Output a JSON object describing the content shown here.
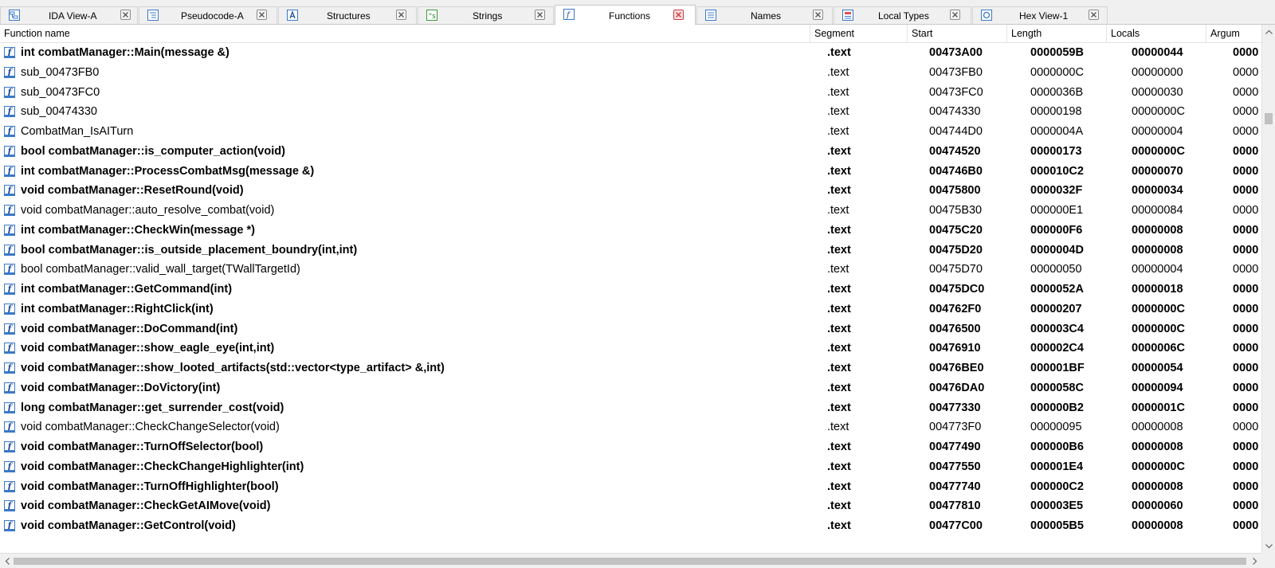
{
  "tabs": [
    {
      "label": "IDA View-A",
      "icon": "ida-view-icon"
    },
    {
      "label": "Pseudocode-A",
      "icon": "pseudocode-icon"
    },
    {
      "label": "Structures",
      "icon": "structures-icon"
    },
    {
      "label": "Strings",
      "icon": "strings-icon"
    },
    {
      "label": "Functions",
      "icon": "functions-icon",
      "active": true
    },
    {
      "label": "Names",
      "icon": "names-icon"
    },
    {
      "label": "Local Types",
      "icon": "local-types-icon"
    },
    {
      "label": "Hex View-1",
      "icon": "hex-view-icon"
    }
  ],
  "columns": {
    "name": "Function name",
    "segment": "Segment",
    "start": "Start",
    "length": "Length",
    "locals": "Locals",
    "arguments": "Argum"
  },
  "colors": {
    "accent_blue": "#3a78c8",
    "active_close_red": "#c94040"
  },
  "functions": [
    {
      "name": "int combatManager::Main(message &)",
      "segment": ".text",
      "start": "00473A00",
      "length": "0000059B",
      "locals": "00000044",
      "args": "0000",
      "bold": true
    },
    {
      "name": "sub_00473FB0",
      "segment": ".text",
      "start": "00473FB0",
      "length": "0000000C",
      "locals": "00000000",
      "args": "0000",
      "bold": false
    },
    {
      "name": "sub_00473FC0",
      "segment": ".text",
      "start": "00473FC0",
      "length": "0000036B",
      "locals": "00000030",
      "args": "0000",
      "bold": false
    },
    {
      "name": "sub_00474330",
      "segment": ".text",
      "start": "00474330",
      "length": "00000198",
      "locals": "0000000C",
      "args": "0000",
      "bold": false
    },
    {
      "name": "CombatMan_IsAITurn",
      "segment": ".text",
      "start": "004744D0",
      "length": "0000004A",
      "locals": "00000004",
      "args": "0000",
      "bold": false
    },
    {
      "name": "bool combatManager::is_computer_action(void)",
      "segment": ".text",
      "start": "00474520",
      "length": "00000173",
      "locals": "0000000C",
      "args": "0000",
      "bold": true
    },
    {
      "name": "int combatManager::ProcessCombatMsg(message &)",
      "segment": ".text",
      "start": "004746B0",
      "length": "000010C2",
      "locals": "00000070",
      "args": "0000",
      "bold": true
    },
    {
      "name": "void combatManager::ResetRound(void)",
      "segment": ".text",
      "start": "00475800",
      "length": "0000032F",
      "locals": "00000034",
      "args": "0000",
      "bold": true
    },
    {
      "name": "void combatManager::auto_resolve_combat(void)",
      "segment": ".text",
      "start": "00475B30",
      "length": "000000E1",
      "locals": "00000084",
      "args": "0000",
      "bold": false
    },
    {
      "name": "int combatManager::CheckWin(message *)",
      "segment": ".text",
      "start": "00475C20",
      "length": "000000F6",
      "locals": "00000008",
      "args": "0000",
      "bold": true
    },
    {
      "name": "bool combatManager::is_outside_placement_boundry(int,int)",
      "segment": ".text",
      "start": "00475D20",
      "length": "0000004D",
      "locals": "00000008",
      "args": "0000",
      "bold": true
    },
    {
      "name": "bool combatManager::valid_wall_target(TWallTargetId)",
      "segment": ".text",
      "start": "00475D70",
      "length": "00000050",
      "locals": "00000004",
      "args": "0000",
      "bold": false
    },
    {
      "name": "int combatManager::GetCommand(int)",
      "segment": ".text",
      "start": "00475DC0",
      "length": "0000052A",
      "locals": "00000018",
      "args": "0000",
      "bold": true
    },
    {
      "name": "int combatManager::RightClick(int)",
      "segment": ".text",
      "start": "004762F0",
      "length": "00000207",
      "locals": "0000000C",
      "args": "0000",
      "bold": true
    },
    {
      "name": "void combatManager::DoCommand(int)",
      "segment": ".text",
      "start": "00476500",
      "length": "000003C4",
      "locals": "0000000C",
      "args": "0000",
      "bold": true
    },
    {
      "name": "void combatManager::show_eagle_eye(int,int)",
      "segment": ".text",
      "start": "00476910",
      "length": "000002C4",
      "locals": "0000006C",
      "args": "0000",
      "bold": true
    },
    {
      "name": "void combatManager::show_looted_artifacts(std::vector<type_artifact> &,int)",
      "segment": ".text",
      "start": "00476BE0",
      "length": "000001BF",
      "locals": "00000054",
      "args": "0000",
      "bold": true
    },
    {
      "name": "void combatManager::DoVictory(int)",
      "segment": ".text",
      "start": "00476DA0",
      "length": "0000058C",
      "locals": "00000094",
      "args": "0000",
      "bold": true
    },
    {
      "name": "long combatManager::get_surrender_cost(void)",
      "segment": ".text",
      "start": "00477330",
      "length": "000000B2",
      "locals": "0000001C",
      "args": "0000",
      "bold": true
    },
    {
      "name": "void combatManager::CheckChangeSelector(void)",
      "segment": ".text",
      "start": "004773F0",
      "length": "00000095",
      "locals": "00000008",
      "args": "0000",
      "bold": false
    },
    {
      "name": "void combatManager::TurnOffSelector(bool)",
      "segment": ".text",
      "start": "00477490",
      "length": "000000B6",
      "locals": "00000008",
      "args": "0000",
      "bold": true
    },
    {
      "name": "void combatManager::CheckChangeHighlighter(int)",
      "segment": ".text",
      "start": "00477550",
      "length": "000001E4",
      "locals": "0000000C",
      "args": "0000",
      "bold": true
    },
    {
      "name": "void combatManager::TurnOffHighlighter(bool)",
      "segment": ".text",
      "start": "00477740",
      "length": "000000C2",
      "locals": "00000008",
      "args": "0000",
      "bold": true
    },
    {
      "name": "void combatManager::CheckGetAIMove(void)",
      "segment": ".text",
      "start": "00477810",
      "length": "000003E5",
      "locals": "00000060",
      "args": "0000",
      "bold": true
    },
    {
      "name": "void combatManager::GetControl(void)",
      "segment": ".text",
      "start": "00477C00",
      "length": "000005B5",
      "locals": "00000008",
      "args": "0000",
      "bold": true
    }
  ]
}
